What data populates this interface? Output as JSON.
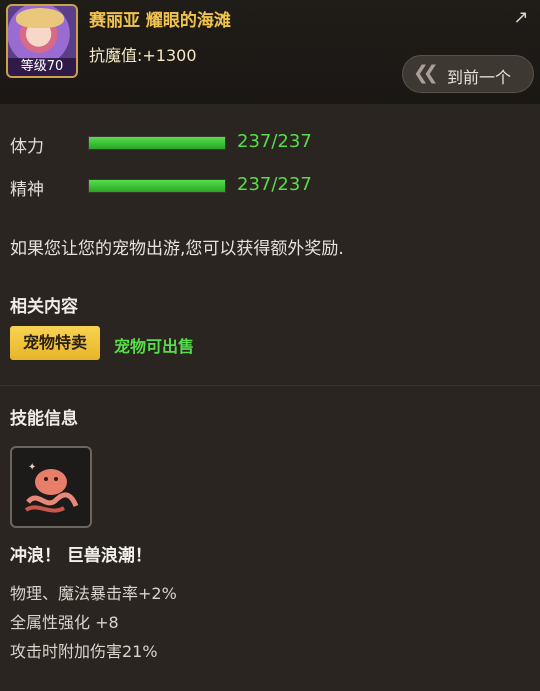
{
  "header": {
    "pet_name": "赛丽亚 耀眼的海滩",
    "resist_label": "抗魔值:+1300",
    "level_badge": "等级70",
    "prev_button": "到前一个"
  },
  "stats": [
    {
      "label": "体力",
      "value": "237/237",
      "fill_fraction": 1.0
    },
    {
      "label": "精神",
      "value": "237/237",
      "fill_fraction": 1.0
    }
  ],
  "description": "如果您让您的宠物出游,您可以获得额外奖励.",
  "related": {
    "title": "相关内容",
    "shop_tag": "宠物特卖",
    "sellable_text": "宠物可出售"
  },
  "skill": {
    "section_title": "技能信息",
    "name": "冲浪！ 巨兽浪潮！",
    "effects": [
      "物理、魔法暴击率+2%",
      "全属性强化 +8",
      "攻击时附加伤害21%"
    ]
  },
  "colors": {
    "accent_gold": "#f0c24e",
    "accent_green": "#58dd4a",
    "background": "#2a2520"
  }
}
